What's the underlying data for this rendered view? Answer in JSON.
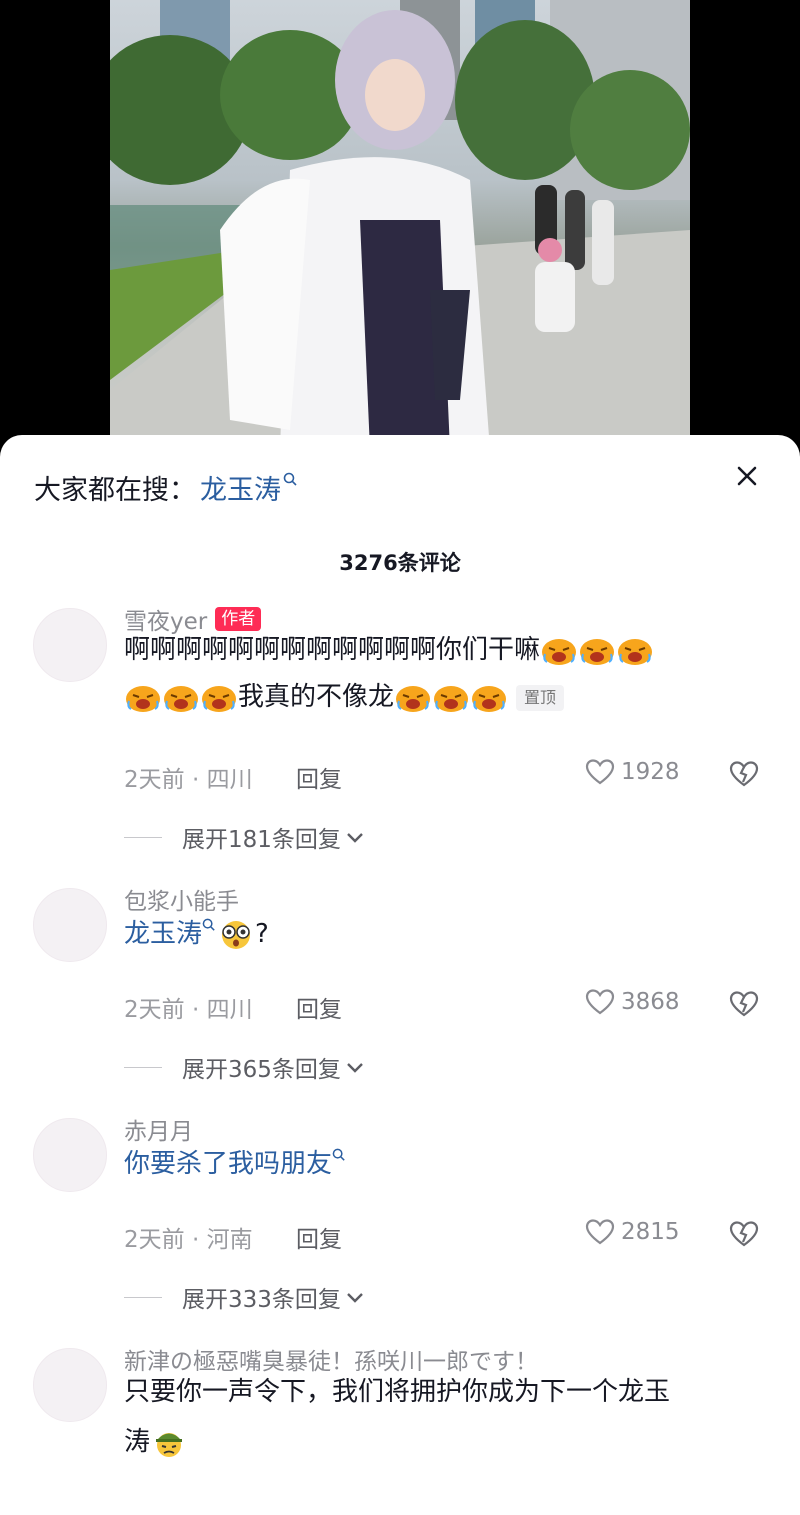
{
  "search_suggestion": {
    "prefix": "大家都在搜：",
    "keyword": "龙玉涛"
  },
  "comment_count": "3276条评论",
  "comments": [
    {
      "user": "雪夜yer",
      "badge": "作者",
      "line1": "啊啊啊啊啊啊啊啊啊啊啊啊你们干嘛",
      "line2": "我真的不像龙",
      "pin_label": "置顶",
      "meta": "2天前 · 四川",
      "reply": "回复",
      "likes": "1928",
      "expand": "展开181条回复"
    },
    {
      "user": "包浆小能手",
      "link": "龙玉涛",
      "tail": "?",
      "meta": "2天前 · 四川",
      "reply": "回复",
      "likes": "3868",
      "expand": "展开365条回复"
    },
    {
      "user": "赤月月",
      "link": "你要杀了我吗朋友",
      "meta": "2天前 · 河南",
      "reply": "回复",
      "likes": "2815",
      "expand": "展开333条回复"
    },
    {
      "user": "新津の極惡嘴臭暴徒！孫咲川一郎です！",
      "line1": "只要你一声令下，我们将拥护你成为下一个龙玉",
      "line2": "涛"
    }
  ],
  "colors": {
    "accent_red": "#fe2c55",
    "link_blue": "#2b5ea0",
    "emoji_orange": "#f7a51c"
  },
  "icons": [
    "search-icon",
    "close-icon",
    "heart-icon",
    "broken-heart-icon",
    "chevron-down-icon",
    "crying-emoji",
    "shocked-emoji",
    "soldier-emoji"
  ]
}
